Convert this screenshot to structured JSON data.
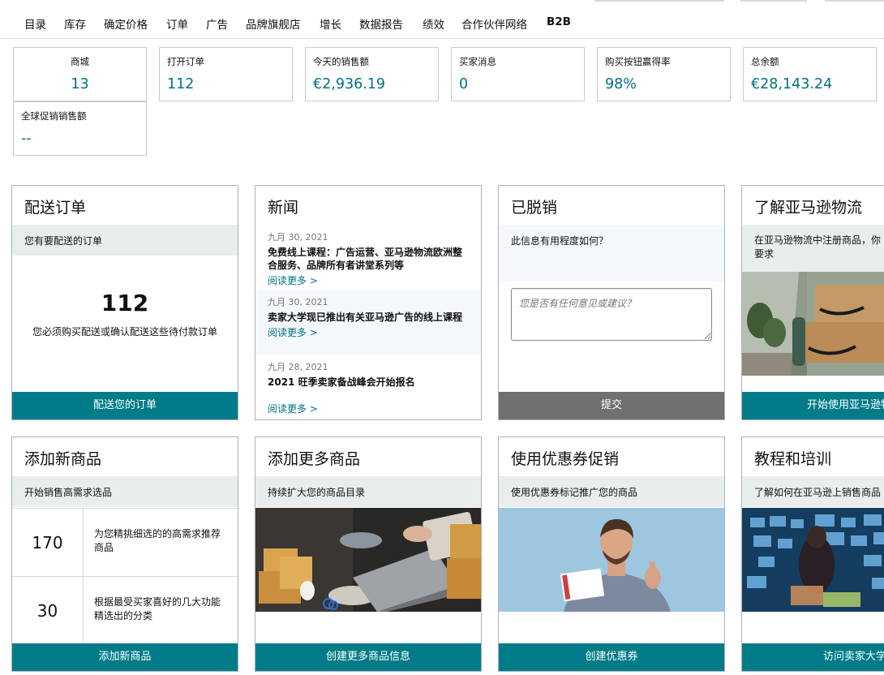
{
  "nav": {
    "items": [
      "目录",
      "库存",
      "确定价格",
      "订单",
      "广告",
      "品牌旗舰店",
      "增长",
      "数据报告",
      "绩效",
      "合作伙伴网络",
      "B2B"
    ]
  },
  "metrics": [
    {
      "label": "商城",
      "value": "13"
    },
    {
      "label": "打开订单",
      "value": "112"
    },
    {
      "label": "今天的销售额",
      "value": "€2,936.19"
    },
    {
      "label": "买家消息",
      "value": "0"
    },
    {
      "label": "购买按钮赢得率",
      "value": "98%"
    },
    {
      "label": "总余额",
      "value": "€28,143.24"
    },
    {
      "label": "全球促销销售额",
      "value": "--"
    }
  ],
  "cards": {
    "ship_orders": {
      "title": "配送订单",
      "band": "您有要配送的订单",
      "count": "112",
      "desc": "您必须购买配送或确认配送这些待付款订单",
      "button": "配送您的订单"
    },
    "news": {
      "title": "新闻",
      "items": [
        {
          "date": "九月 30, 2021",
          "title": "免费线上课程：广告运营、亚马逊物流欧洲整合服务、品牌所有者讲堂系列等",
          "more": "阅读更多 >"
        },
        {
          "date": "九月 30, 2021",
          "title": "卖家大学现已推出有关亚马逊广告的线上课程",
          "more": "阅读更多 >"
        },
        {
          "date": "九月 28, 2021",
          "title": "2021 旺季卖家备战峰会开始报名",
          "more": "阅读更多 >"
        }
      ]
    },
    "feedback": {
      "title": "已脱销",
      "question": "此信息有用程度如何？",
      "placeholder": "您是否有任何意见或建议？",
      "button": "提交"
    },
    "fba": {
      "title": "了解亚马逊物流",
      "band": "在亚马逊物流中注册商品，你要求",
      "button": "开始使用亚马逊物流"
    },
    "add_product": {
      "title": "添加新商品",
      "band": "开始销售高需求选品",
      "rows": [
        {
          "count": "170",
          "desc": "为您精挑细选的的高需求推荐商品"
        },
        {
          "count": "30",
          "desc": "根据最受买家喜好的几大功能精选出的分类"
        }
      ],
      "button": "添加新商品"
    },
    "add_more": {
      "title": "添加更多商品",
      "band": "持续扩大您的商品目录",
      "button": "创建更多商品信息"
    },
    "coupons": {
      "title": "使用优惠券促销",
      "band": "使用优惠券标记推广您的商品",
      "button": "创建优惠券"
    },
    "training": {
      "title": "教程和培训",
      "band": "了解如何在亚马逊上销售商品",
      "button": "访问卖家大学"
    }
  },
  "colors": {
    "accent": "#007c89",
    "link": "#007185",
    "band": "#e8eeed",
    "grey_button": "#707070"
  }
}
